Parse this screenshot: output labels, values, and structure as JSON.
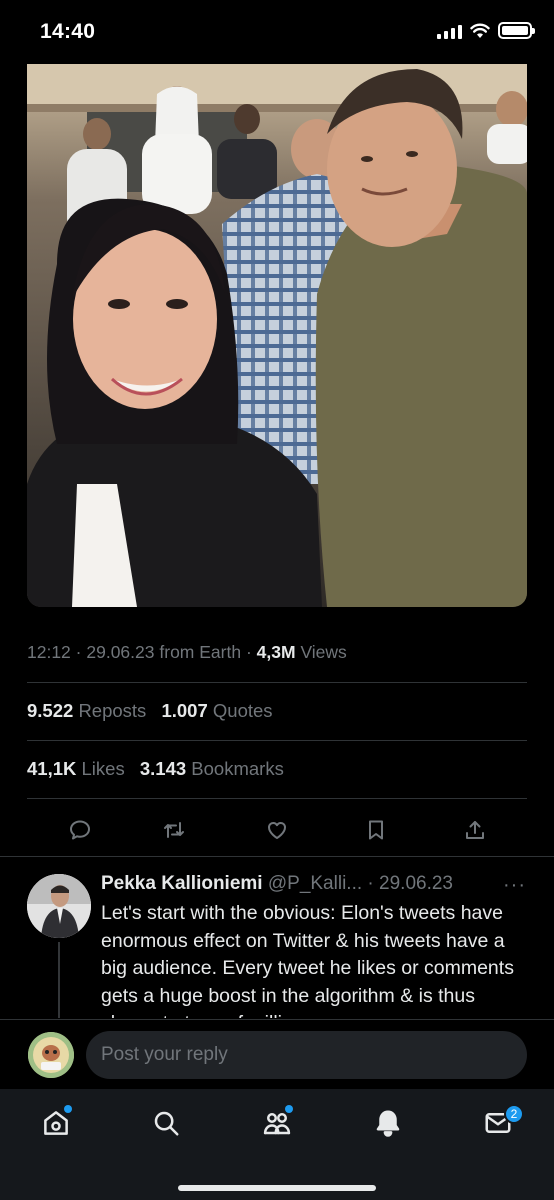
{
  "status_bar": {
    "time": "14:40",
    "signal_icon": "signal-icon",
    "wifi_icon": "wifi-icon",
    "battery_icon": "battery-icon"
  },
  "tweet": {
    "time": "12:12",
    "date": "29.06.23",
    "source": "from Earth",
    "views_count": "4,3M",
    "views_label": "Views",
    "reposts_count": "9.522",
    "reposts_label": "Reposts",
    "quotes_count": "1.007",
    "quotes_label": "Quotes",
    "likes_count": "41,1K",
    "likes_label": "Likes",
    "bookmarks_count": "3.143",
    "bookmarks_label": "Bookmarks"
  },
  "actions": [
    {
      "name": "reply",
      "icon": "comment-icon"
    },
    {
      "name": "repost",
      "icon": "repost-icon"
    },
    {
      "name": "like",
      "icon": "heart-icon"
    },
    {
      "name": "bookmark",
      "icon": "bookmark-icon"
    },
    {
      "name": "share",
      "icon": "share-icon"
    }
  ],
  "reply_tweet": {
    "name": "Pekka Kallioniemi",
    "handle": "@P_Kalli...",
    "date": "· 29.06.23",
    "more": "···",
    "text": "Let's start with the obvious: Elon's tweets have enormous effect on Twitter & his tweets have a big audience. Every tweet he likes or comments gets a huge boost in the algorithm & is thus shown to tens of millions"
  },
  "composer": {
    "placeholder": "Post your reply"
  },
  "bottom_nav": {
    "items": [
      "home-icon",
      "search-icon",
      "communities-icon",
      "notifications-icon",
      "messages-icon"
    ],
    "messages_badge": "2"
  },
  "colors": {
    "background": "#000000",
    "text": "#e7e9ea",
    "secondary": "#71767b",
    "accent": "#1d9bf0",
    "divider": "#2f3336"
  }
}
